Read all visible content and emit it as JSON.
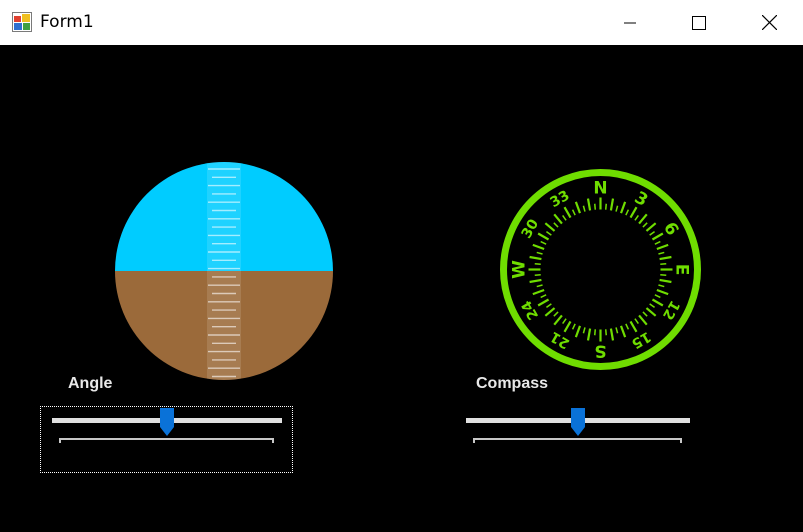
{
  "window": {
    "title": "Form1",
    "icon": "winforms-app-icon",
    "controls": [
      "minimize-icon",
      "maximize-icon",
      "close-icon"
    ]
  },
  "attitude_indicator": {
    "sky_color": "#00CCFF",
    "ground_color": "#9B6A3A",
    "horizon_level": 0.5
  },
  "compass": {
    "ring_color": "#6FDD00",
    "cardinal_labels": [
      "N",
      "3",
      "6",
      "E",
      "12",
      "15",
      "S",
      "21",
      "24",
      "W",
      "30",
      "33"
    ],
    "heading": 0
  },
  "angle_slider": {
    "label": "Angle",
    "value_fraction": 0.5,
    "focused": true
  },
  "compass_slider": {
    "label": "Compass",
    "value_fraction": 0.5,
    "focused": false
  },
  "colors": {
    "accent": "#0A72D8",
    "track": "#E0E0E0",
    "background": "#000000"
  }
}
